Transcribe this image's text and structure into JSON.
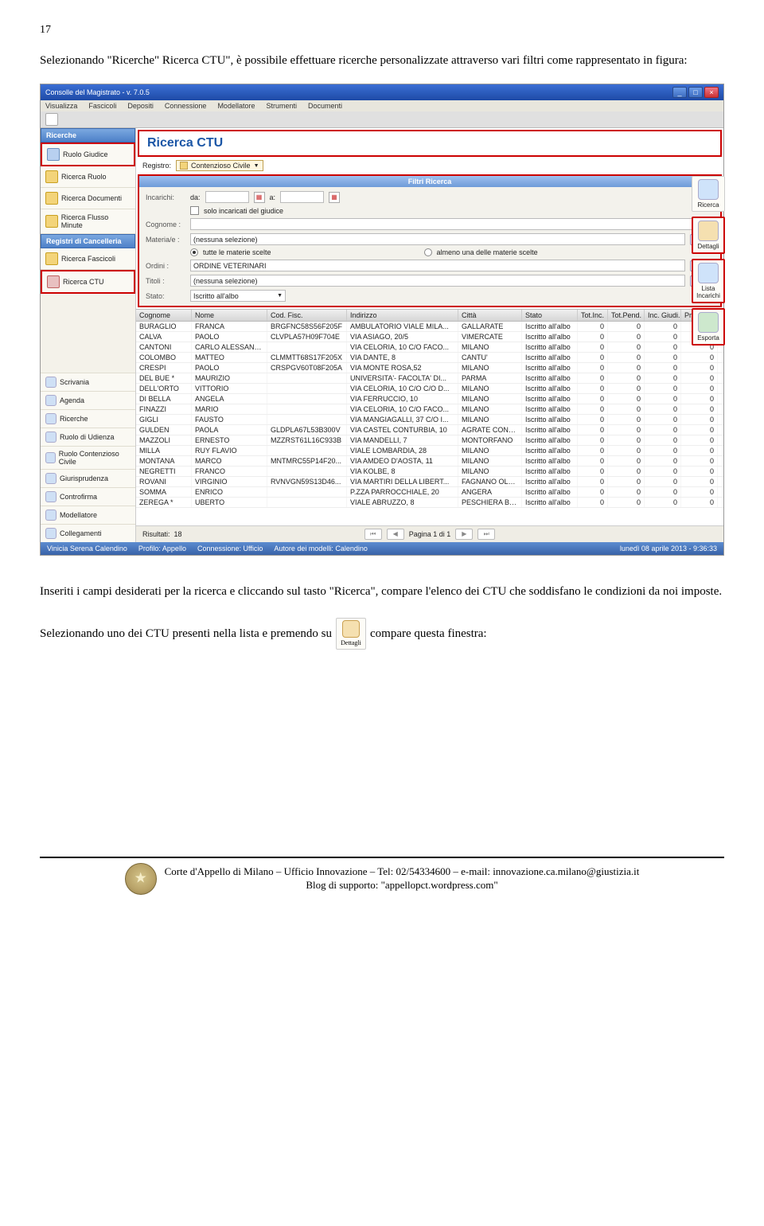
{
  "page_number": "17",
  "intro": "Selezionando \"Ricerche\" Ricerca CTU\", è possibile effettuare ricerche personalizzate attraverso vari filtri come rappresentato in figura:",
  "mid": "Inseriti i campi desiderati per la ricerca e cliccando sul tasto \"Ricerca\", compare l'elenco dei CTU che soddisfano le condizioni da noi imposte.",
  "sel1": "Selezionando uno dei CTU presenti nella lista e premendo su",
  "sel_icon": "Dettagli",
  "sel2": "compare questa finestra:",
  "app": {
    "title": "Consolle del Magistrato - v. 7.0.5",
    "menu": [
      "Visualizza",
      "Fascicoli",
      "Depositi",
      "Connessione",
      "Modellatore",
      "Strumenti",
      "Documenti"
    ]
  },
  "sidebar": {
    "ricerche": "Ricerche",
    "items_top": [
      {
        "label": "Ruolo Giudice",
        "ico": "blue",
        "sel": true
      },
      {
        "label": "Ricerca Ruolo",
        "ico": "yellow"
      },
      {
        "label": "Ricerca Documenti",
        "ico": "yellow"
      },
      {
        "label": "Ricerca Flusso Minute",
        "ico": "yellow"
      }
    ],
    "registri": "Registri di Cancelleria",
    "items_mid": [
      {
        "label": "Ricerca Fascicoli",
        "ico": "yellow"
      },
      {
        "label": "Ricerca CTU",
        "ico": "red",
        "sel": true
      }
    ],
    "nav": [
      "Scrivania",
      "Agenda",
      "Ricerche",
      "Ruolo di Udienza",
      "Ruolo Contenzioso Civile",
      "Giurisprudenza",
      "Controfirma",
      "Modellatore",
      "Collegamenti"
    ]
  },
  "main": {
    "heading": "Ricerca CTU",
    "registro_label": "Registro:",
    "registro_value": "Contenzioso Civile",
    "filter_header": "Filtri Ricerca",
    "labels": {
      "incarichi": "Incarichi:",
      "da": "da:",
      "a": "a:",
      "solo": "solo incaricati del giudice",
      "cognome": "Cognome :",
      "materiale": "Materia/e :",
      "materiale_val": "(nessuna selezione)",
      "tutte": "tutte le materie scelte",
      "almeno": "almeno una delle materie scelte",
      "ordini": "Ordini :",
      "ordini_val": "ORDINE VETERINARI",
      "titoli": "Titoli :",
      "titoli_val": "(nessuna selezione)",
      "stato": "Stato:",
      "stato_val": "Iscritto all'albo"
    },
    "columns": [
      "Cognome",
      "Nome",
      "Cod. Fisc.",
      "Indirizzo",
      "Città",
      "Stato",
      "Tot.Inc.",
      "Tot.Pend.",
      "Inc. Giudi...",
      "Proroghe"
    ],
    "rows": [
      [
        "BURAGLIO",
        "FRANCA",
        "BRGFNC58S56F205F",
        "AMBULATORIO VIALE MILA...",
        "GALLARATE",
        "Iscritto all'albo",
        "0",
        "0",
        "0",
        "0"
      ],
      [
        "CALVA",
        "PAOLO",
        "CLVPLA57H09F704E",
        "VIA ASIAGO, 20/5",
        "VIMERCATE",
        "Iscritto all'albo",
        "0",
        "0",
        "0",
        "0"
      ],
      [
        "CANTONI",
        "CARLO ALESSAND...",
        "",
        "VIA CELORIA, 10 C/O FACO...",
        "MILANO",
        "Iscritto all'albo",
        "0",
        "0",
        "0",
        "0"
      ],
      [
        "COLOMBO",
        "MATTEO",
        "CLMMTT68S17F205X",
        "VIA DANTE, 8",
        "CANTU'",
        "Iscritto all'albo",
        "0",
        "0",
        "0",
        "0"
      ],
      [
        "CRESPI",
        "PAOLO",
        "CRSPGV60T08F205A",
        "VIA MONTE ROSA,52",
        "MILANO",
        "Iscritto all'albo",
        "0",
        "0",
        "0",
        "0"
      ],
      [
        "DEL BUE *",
        "MAURIZIO",
        "",
        "UNIVERSITA'- FACOLTA' DI...",
        "PARMA",
        "Iscritto all'albo",
        "0",
        "0",
        "0",
        "0"
      ],
      [
        "DELL'ORTO",
        "VITTORIO",
        "",
        "VIA CELORIA, 10 C/O C/O D...",
        "MILANO",
        "Iscritto all'albo",
        "0",
        "0",
        "0",
        "0"
      ],
      [
        "DI BELLA",
        "ANGELA",
        "",
        "VIA FERRUCCIO, 10",
        "MILANO",
        "Iscritto all'albo",
        "0",
        "0",
        "0",
        "0"
      ],
      [
        "FINAZZI",
        "MARIO",
        "",
        "VIA CELORIA, 10  C/O FACO...",
        "MILANO",
        "Iscritto all'albo",
        "0",
        "0",
        "0",
        "0"
      ],
      [
        "GIGLI",
        "FAUSTO",
        "",
        "VIA MANGIAGALLI, 37  C/O I...",
        "MILANO",
        "Iscritto all'albo",
        "0",
        "0",
        "0",
        "0"
      ],
      [
        "GULDEN",
        "PAOLA",
        "GLDPLA67L53B300V",
        "VIA CASTEL CONTURBIA, 10",
        "AGRATE CONTU...",
        "Iscritto all'albo",
        "0",
        "0",
        "0",
        "0"
      ],
      [
        "MAZZOLI",
        "ERNESTO",
        "MZZRST61L16C933B",
        "VIA MANDELLI, 7",
        "MONTORFANO",
        "Iscritto all'albo",
        "0",
        "0",
        "0",
        "0"
      ],
      [
        "MILLA",
        "RUY FLAVIO",
        "",
        "VIALE LOMBARDIA, 28",
        "MILANO",
        "Iscritto all'albo",
        "0",
        "0",
        "0",
        "0"
      ],
      [
        "MONTANA",
        "MARCO",
        "MNTMRC55P14F20...",
        "VIA AMDEO D'AOSTA, 11",
        "MILANO",
        "Iscritto all'albo",
        "0",
        "0",
        "0",
        "0"
      ],
      [
        "NEGRETTI",
        "FRANCO",
        "",
        "VIA KOLBE, 8",
        "MILANO",
        "Iscritto all'albo",
        "0",
        "0",
        "0",
        "0"
      ],
      [
        "ROVANI",
        "VIRGINIO",
        "RVNVGN59S13D46...",
        "VIA MARTIRI DELLA LIBERT...",
        "FAGNANO OLONA",
        "Iscritto all'albo",
        "0",
        "0",
        "0",
        "0"
      ],
      [
        "SOMMA",
        "ENRICO",
        "",
        "P.ZZA PARROCCHIALE, 20",
        "ANGERA",
        "Iscritto all'albo",
        "0",
        "0",
        "0",
        "0"
      ],
      [
        "ZEREGA *",
        "UBERTO",
        "",
        "VIALE ABRUZZO, 8",
        "PESCHIERA BO...",
        "Iscritto all'albo",
        "0",
        "0",
        "0",
        "0"
      ]
    ],
    "right_tools": [
      {
        "label": "Ricerca",
        "cls": "doc"
      },
      {
        "label": "Dettagli",
        "cls": "person",
        "red": true
      },
      {
        "label": "Lista Incarichi",
        "cls": "doc",
        "red": true
      },
      {
        "label": "Esporta",
        "cls": "xls",
        "red": true
      }
    ],
    "results_label": "Risultati:",
    "results_count": "18",
    "page_label": "Pagina 1 di 1"
  },
  "status": {
    "user": "Vinicia Serena Calendino",
    "profilo": "Profilo: Appello",
    "conn": "Connessione: Ufficio",
    "autore": "Autore dei modelli: Calendino",
    "date": "lunedì 08 aprile 2013 - 9:36:33"
  },
  "footer": {
    "line1": "Corte d'Appello di Milano – Ufficio Innovazione – Tel: 02/54334600 – e-mail: innovazione.ca.milano@giustizia.it",
    "line2": "Blog di supporto: \"appellopct.wordpress.com\""
  }
}
